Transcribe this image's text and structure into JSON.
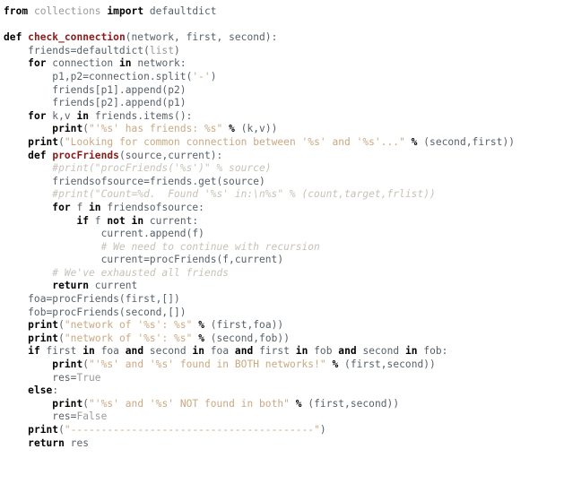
{
  "editor": {
    "language": "Python",
    "background": "#ffffff",
    "colors": {
      "keyword": "#000000",
      "function_name": "#8b1a1a",
      "builtin": "#9a9a9a",
      "string": "#c9a882",
      "comment": "#c7c2b8",
      "plain": "#57606a",
      "operator": "#000000"
    }
  },
  "code": {
    "lines": [
      [
        {
          "t": "from",
          "c": "kw"
        },
        {
          "t": " ",
          "c": "pl"
        },
        {
          "t": "collections",
          "c": "bi"
        },
        {
          "t": " ",
          "c": "pl"
        },
        {
          "t": "import",
          "c": "kw"
        },
        {
          "t": " defaultdict",
          "c": "pl"
        }
      ],
      [],
      [
        {
          "t": "def",
          "c": "kw"
        },
        {
          "t": " ",
          "c": "pl"
        },
        {
          "t": "check_connection",
          "c": "fn"
        },
        {
          "t": "(network, first, second):",
          "c": "pl"
        }
      ],
      [
        {
          "t": "    friends=defaultdict(",
          "c": "pl"
        },
        {
          "t": "list",
          "c": "bi"
        },
        {
          "t": ")",
          "c": "pl"
        }
      ],
      [
        {
          "t": "    ",
          "c": "pl"
        },
        {
          "t": "for",
          "c": "kw"
        },
        {
          "t": " connection ",
          "c": "pl"
        },
        {
          "t": "in",
          "c": "kw"
        },
        {
          "t": " network:",
          "c": "pl"
        }
      ],
      [
        {
          "t": "        p1,p2=connection.split(",
          "c": "pl"
        },
        {
          "t": "'-'",
          "c": "str"
        },
        {
          "t": ")",
          "c": "pl"
        }
      ],
      [
        {
          "t": "        friends[p1].append(p2)",
          "c": "pl"
        }
      ],
      [
        {
          "t": "        friends[p2].append(p1)",
          "c": "pl"
        }
      ],
      [
        {
          "t": "    ",
          "c": "pl"
        },
        {
          "t": "for",
          "c": "kw"
        },
        {
          "t": " k,v ",
          "c": "pl"
        },
        {
          "t": "in",
          "c": "kw"
        },
        {
          "t": " friends.items():",
          "c": "pl"
        }
      ],
      [
        {
          "t": "        ",
          "c": "pl"
        },
        {
          "t": "print",
          "c": "bfn"
        },
        {
          "t": "(",
          "c": "pl"
        },
        {
          "t": "\"'%s' has friends: %s\"",
          "c": "str"
        },
        {
          "t": " ",
          "c": "pl"
        },
        {
          "t": "%",
          "c": "op"
        },
        {
          "t": " (k,v))",
          "c": "pl"
        }
      ],
      [
        {
          "t": "    ",
          "c": "pl"
        },
        {
          "t": "print",
          "c": "bfn"
        },
        {
          "t": "(",
          "c": "pl"
        },
        {
          "t": "\"Looking for common connection between '%s' and '%s'...\"",
          "c": "str"
        },
        {
          "t": " ",
          "c": "pl"
        },
        {
          "t": "%",
          "c": "op"
        },
        {
          "t": " (second,first))",
          "c": "pl"
        }
      ],
      [
        {
          "t": "    ",
          "c": "pl"
        },
        {
          "t": "def",
          "c": "kw"
        },
        {
          "t": " ",
          "c": "pl"
        },
        {
          "t": "procFriends",
          "c": "fn"
        },
        {
          "t": "(source,current):",
          "c": "pl"
        }
      ],
      [
        {
          "t": "        #print(\"procFriends('%s')\" % source)",
          "c": "cm"
        }
      ],
      [
        {
          "t": "        friendsofsource=friends.get(source)",
          "c": "pl"
        }
      ],
      [
        {
          "t": "        #print(\"Count=%d.  Found '%s' in:\\n%s\" % (count,target,frlist))",
          "c": "cm"
        }
      ],
      [
        {
          "t": "        ",
          "c": "pl"
        },
        {
          "t": "for",
          "c": "kw"
        },
        {
          "t": " f ",
          "c": "pl"
        },
        {
          "t": "in",
          "c": "kw"
        },
        {
          "t": " friendsofsource:",
          "c": "pl"
        }
      ],
      [
        {
          "t": "            ",
          "c": "pl"
        },
        {
          "t": "if",
          "c": "kw"
        },
        {
          "t": " f ",
          "c": "pl"
        },
        {
          "t": "not",
          "c": "kw"
        },
        {
          "t": " ",
          "c": "pl"
        },
        {
          "t": "in",
          "c": "kw"
        },
        {
          "t": " current:",
          "c": "pl"
        }
      ],
      [
        {
          "t": "                current.append(f)",
          "c": "pl"
        }
      ],
      [
        {
          "t": "                # We need to continue with recursion",
          "c": "cm"
        }
      ],
      [
        {
          "t": "                current=procFriends(f,current)",
          "c": "pl"
        }
      ],
      [
        {
          "t": "        # We've exhausted all friends",
          "c": "cm"
        }
      ],
      [
        {
          "t": "        ",
          "c": "pl"
        },
        {
          "t": "return",
          "c": "kw"
        },
        {
          "t": " current",
          "c": "pl"
        }
      ],
      [
        {
          "t": "    foa=procFriends(first,[])",
          "c": "pl"
        }
      ],
      [
        {
          "t": "    fob=procFriends(second,[])",
          "c": "pl"
        }
      ],
      [
        {
          "t": "    ",
          "c": "pl"
        },
        {
          "t": "print",
          "c": "bfn"
        },
        {
          "t": "(",
          "c": "pl"
        },
        {
          "t": "\"network of '%s': %s\"",
          "c": "str"
        },
        {
          "t": " ",
          "c": "pl"
        },
        {
          "t": "%",
          "c": "op"
        },
        {
          "t": " (first,foa))",
          "c": "pl"
        }
      ],
      [
        {
          "t": "    ",
          "c": "pl"
        },
        {
          "t": "print",
          "c": "bfn"
        },
        {
          "t": "(",
          "c": "pl"
        },
        {
          "t": "\"network of '%s': %s\"",
          "c": "str"
        },
        {
          "t": " ",
          "c": "pl"
        },
        {
          "t": "%",
          "c": "op"
        },
        {
          "t": " (second,fob))",
          "c": "pl"
        }
      ],
      [
        {
          "t": "    ",
          "c": "pl"
        },
        {
          "t": "if",
          "c": "kw"
        },
        {
          "t": " first ",
          "c": "pl"
        },
        {
          "t": "in",
          "c": "kw"
        },
        {
          "t": " foa ",
          "c": "pl"
        },
        {
          "t": "and",
          "c": "kw"
        },
        {
          "t": " second ",
          "c": "pl"
        },
        {
          "t": "in",
          "c": "kw"
        },
        {
          "t": " foa ",
          "c": "pl"
        },
        {
          "t": "and",
          "c": "kw"
        },
        {
          "t": " first ",
          "c": "pl"
        },
        {
          "t": "in",
          "c": "kw"
        },
        {
          "t": " fob ",
          "c": "pl"
        },
        {
          "t": "and",
          "c": "kw"
        },
        {
          "t": " second ",
          "c": "pl"
        },
        {
          "t": "in",
          "c": "kw"
        },
        {
          "t": " fob:",
          "c": "pl"
        }
      ],
      [
        {
          "t": "        ",
          "c": "pl"
        },
        {
          "t": "print",
          "c": "bfn"
        },
        {
          "t": "(",
          "c": "pl"
        },
        {
          "t": "\"'%s' and '%s' found in BOTH networks!\"",
          "c": "str"
        },
        {
          "t": " ",
          "c": "pl"
        },
        {
          "t": "%",
          "c": "op"
        },
        {
          "t": " (first,second))",
          "c": "pl"
        }
      ],
      [
        {
          "t": "        res=",
          "c": "pl"
        },
        {
          "t": "True",
          "c": "bi"
        }
      ],
      [
        {
          "t": "    ",
          "c": "pl"
        },
        {
          "t": "else",
          "c": "kw"
        },
        {
          "t": ":",
          "c": "pl"
        }
      ],
      [
        {
          "t": "        ",
          "c": "pl"
        },
        {
          "t": "print",
          "c": "bfn"
        },
        {
          "t": "(",
          "c": "pl"
        },
        {
          "t": "\"'%s' and '%s' NOT found in both\"",
          "c": "str"
        },
        {
          "t": " ",
          "c": "pl"
        },
        {
          "t": "%",
          "c": "op"
        },
        {
          "t": " (first,second))",
          "c": "pl"
        }
      ],
      [
        {
          "t": "        res=",
          "c": "pl"
        },
        {
          "t": "False",
          "c": "bi"
        }
      ],
      [
        {
          "t": "    ",
          "c": "pl"
        },
        {
          "t": "print",
          "c": "bfn"
        },
        {
          "t": "(",
          "c": "pl"
        },
        {
          "t": "\"----------------------------------------\"",
          "c": "str"
        },
        {
          "t": ")",
          "c": "pl"
        }
      ],
      [
        {
          "t": "    ",
          "c": "pl"
        },
        {
          "t": "return",
          "c": "kw"
        },
        {
          "t": " res",
          "c": "pl"
        }
      ]
    ]
  }
}
